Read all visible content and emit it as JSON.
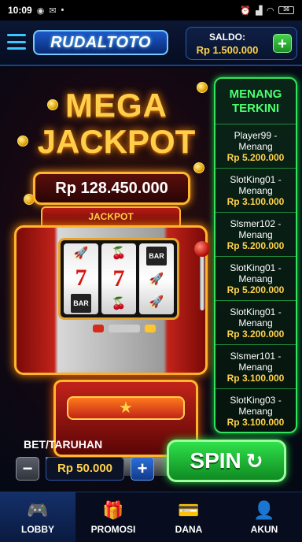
{
  "statusbar": {
    "time": "10:09",
    "battery": "36"
  },
  "header": {
    "logo_text": "RUDALTOTO",
    "saldo_label": "SALDO:",
    "saldo_value": "Rp 1.500.000",
    "add_label": "+"
  },
  "hero": {
    "line1": "MEGA",
    "line2": "JACKPOT",
    "jackpot_amount": "Rp 128.450.000",
    "machine_label": "JACKPOT"
  },
  "reels": [
    [
      "🚀",
      "7",
      "BAR"
    ],
    [
      "🍒",
      "7",
      "🍒"
    ],
    [
      "BAR",
      "🚀",
      "🚀"
    ]
  ],
  "winners": {
    "title_line1": "MENANG",
    "title_line2": "TERKINI",
    "items": [
      {
        "name": "Player99 -",
        "status": "Menang",
        "amount": "Rp 5.200.000"
      },
      {
        "name": "SlotKing01 -",
        "status": "Menang",
        "amount": "Rp 3.100.000"
      },
      {
        "name": "Slsmer102 -",
        "status": "Menang",
        "amount": "Rp 5.200.000"
      },
      {
        "name": "SlotKing01 -",
        "status": "Menang",
        "amount": "Rp 5.200.000"
      },
      {
        "name": "SlotKing01 -",
        "status": "Menang",
        "amount": "Rp 3.200.000"
      },
      {
        "name": "Slsmer101 -",
        "status": "Menang",
        "amount": "Rp 3.100.000"
      },
      {
        "name": "SlotKing03 -",
        "status": "Menang",
        "amount": "Rp 3.100.000"
      }
    ]
  },
  "bet": {
    "label": "BET/TARUHAN",
    "minus": "−",
    "value": "Rp 50.000",
    "plus": "+"
  },
  "spin": {
    "label": "SPIN",
    "icon": "↻"
  },
  "nav": {
    "items": [
      {
        "label": "LOBBY",
        "icon": "🎮"
      },
      {
        "label": "PROMOSI",
        "icon": "🎁"
      },
      {
        "label": "DANA",
        "icon": "💳"
      },
      {
        "label": "AKUN",
        "icon": "👤"
      }
    ]
  },
  "colors": {
    "gold": "#ffd24a",
    "green": "#35e35a",
    "blue": "#2c6fd8"
  }
}
